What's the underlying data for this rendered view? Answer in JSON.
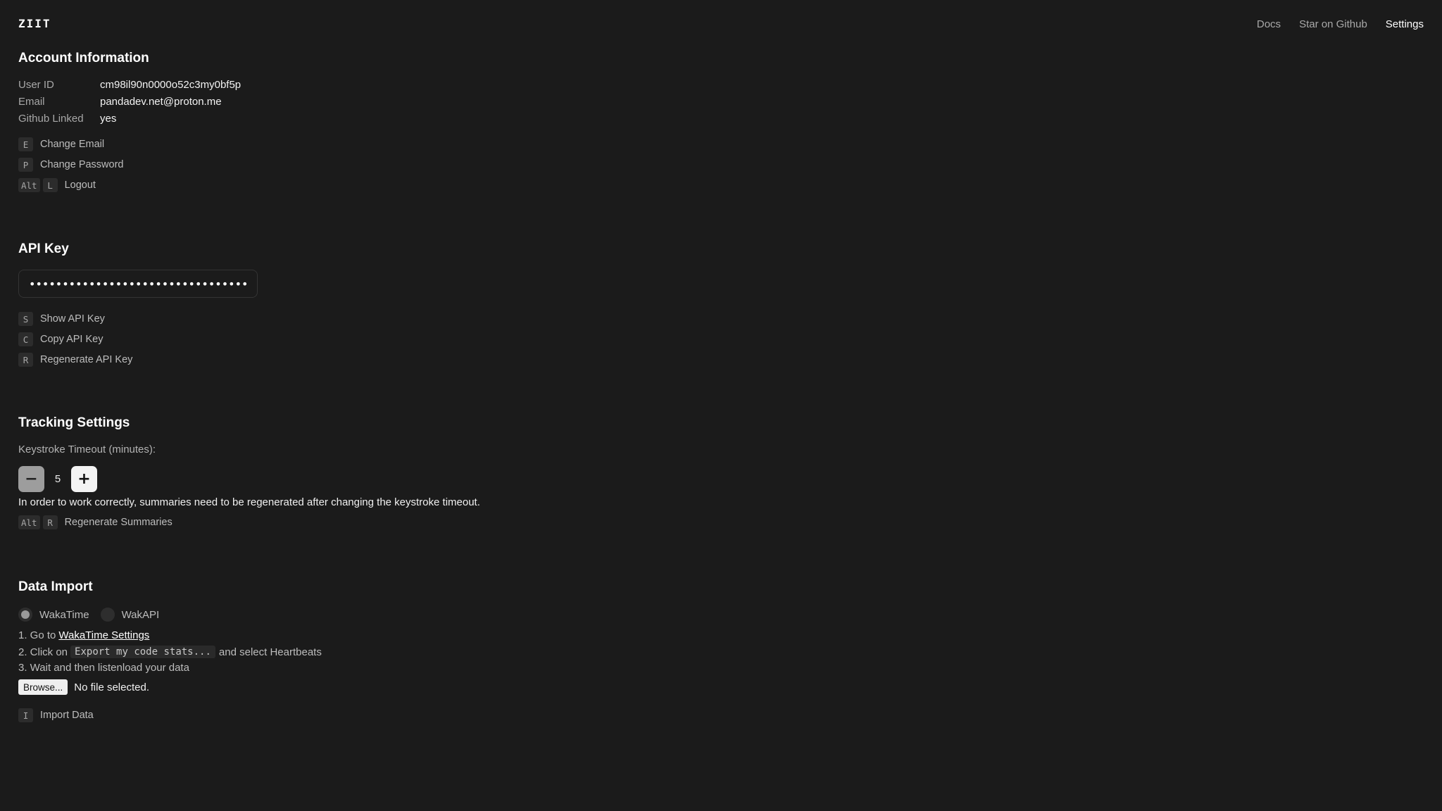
{
  "app": {
    "logo": "ZIIT"
  },
  "nav": {
    "docs": "Docs",
    "github": "Star on Github",
    "settings": "Settings"
  },
  "account": {
    "title": "Account Information",
    "rows": [
      {
        "label": "User ID",
        "value": "cm98il90n0000o52c3my0bf5p"
      },
      {
        "label": "Email",
        "value": "pandadev.net@proton.me"
      },
      {
        "label": "Github Linked",
        "value": "yes"
      }
    ],
    "actions": [
      {
        "keys": [
          "E"
        ],
        "label": "Change Email"
      },
      {
        "keys": [
          "P"
        ],
        "label": "Change Password"
      },
      {
        "keys": [
          "Alt",
          "L"
        ],
        "label": "Logout"
      }
    ]
  },
  "api": {
    "title": "API Key",
    "masked_value": "••••••••••••••••••••••••••••••••••••",
    "actions": [
      {
        "keys": [
          "S"
        ],
        "label": "Show API Key"
      },
      {
        "keys": [
          "C"
        ],
        "label": "Copy API Key"
      },
      {
        "keys": [
          "R"
        ],
        "label": "Regenerate API Key"
      }
    ]
  },
  "tracking": {
    "title": "Tracking Settings",
    "timeout_label": "Keystroke Timeout (minutes):",
    "timeout_value": "5",
    "minus_symbol": "−",
    "plus_symbol": "+",
    "note": "In order to work correctly, summaries need to be regenerated after changing the keystroke timeout.",
    "action": {
      "keys": [
        "Alt",
        "R"
      ],
      "label": "Regenerate Summaries"
    }
  },
  "import": {
    "title": "Data Import",
    "options": [
      {
        "label": "WakaTime",
        "selected": true
      },
      {
        "label": "WakAPI",
        "selected": false
      }
    ],
    "step1_prefix": "1. Go to",
    "step1_link": "WakaTime Settings",
    "step2_prefix": "2. Click on",
    "step2_code": "Export my code stats...",
    "step2_suffix": "and select Heartbeats",
    "step3": "3. Wait and then listenload your data",
    "browse_label": "Browse...",
    "file_status": "No file selected.",
    "action": {
      "keys": [
        "I"
      ],
      "label": "Import Data"
    }
  }
}
